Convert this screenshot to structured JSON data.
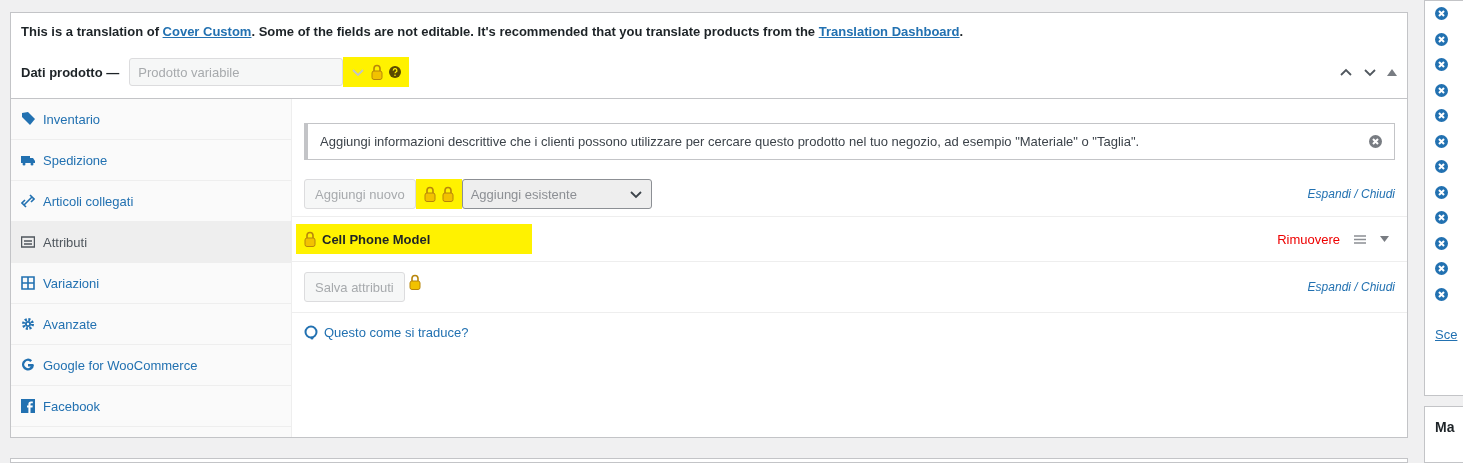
{
  "notice": {
    "parts": [
      {
        "kind": "text",
        "text": "This is a translation of "
      },
      {
        "kind": "link",
        "text": "Cover Custom"
      },
      {
        "kind": "text",
        "text": ". Some of the fields are not editable. It's recommended that you translate products from the "
      },
      {
        "kind": "link",
        "text": "Translation Dashboard"
      },
      {
        "kind": "text",
        "text": "."
      }
    ]
  },
  "product_data": {
    "label": "Dati prodotto —",
    "type_select": {
      "value": "Prodotto variabile",
      "disabled": true
    },
    "highlighted": true
  },
  "tabs": [
    {
      "label": "Inventario",
      "kind": "tag",
      "selected": false
    },
    {
      "label": "Spedizione",
      "kind": "truck",
      "selected": false
    },
    {
      "label": "Articoli collegati",
      "kind": "link",
      "selected": false
    },
    {
      "label": "Attributi",
      "kind": "card",
      "selected": true
    },
    {
      "label": "Variazioni",
      "kind": "grid",
      "selected": false
    },
    {
      "label": "Avanzate",
      "kind": "gear",
      "selected": false
    },
    {
      "label": "Google for WooCommerce",
      "kind": "google",
      "selected": false
    },
    {
      "label": "Facebook",
      "kind": "facebook",
      "selected": false
    }
  ],
  "info_notice": "Aggiungi informazioni descrittive che i clienti possono utilizzare per cercare questo prodotto nel tuo negozio, ad esempio \"Materiale\" o \"Taglia\".",
  "toolbar": {
    "add_new": {
      "label": "Aggiungi nuovo",
      "disabled": true
    },
    "add_existing": {
      "placeholder": "Aggiungi esistente"
    },
    "expand_link": "Espandi / Chiudi",
    "highlighted": true
  },
  "attribute": {
    "name": "Cell Phone Model",
    "remove": "Rimuovere",
    "highlighted": true
  },
  "save": {
    "label": "Salva attributi",
    "disabled": true,
    "expand_link": "Espandi / Chiudi"
  },
  "help_link": "Questo come si traduce?",
  "side": {
    "link": "Sce",
    "next_heading": "Ma"
  }
}
